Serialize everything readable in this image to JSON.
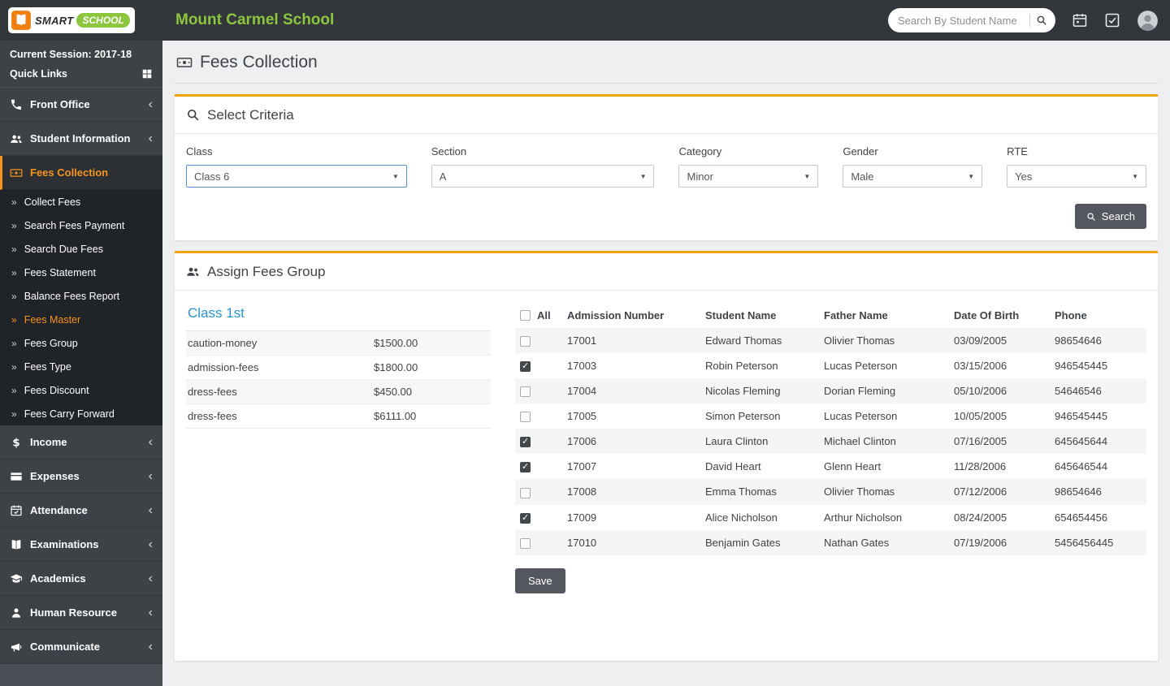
{
  "colors": {
    "accent_orange": "#f0a30a",
    "sidebar_active_orange": "#f7941e",
    "brand_green": "#8cc63e",
    "heading_blue": "#2a93c9",
    "topbar_bg": "#33373c",
    "sidebar_bg": "#3d4247",
    "button_gray": "#54585e"
  },
  "topbar": {
    "brand_part1": "SMART",
    "brand_part2": "SCHOOL",
    "school_name": "Mount Carmel School",
    "search_placeholder": "Search By Student Name"
  },
  "sidebar": {
    "session_label": "Current Session: 2017-18",
    "quick_links_label": "Quick Links",
    "items": [
      {
        "label": "Front Office",
        "icon": "phone-icon"
      },
      {
        "label": "Student Information",
        "icon": "users-icon"
      },
      {
        "label": "Fees Collection",
        "icon": "banknote-icon",
        "active": true
      },
      {
        "label": "Income",
        "icon": "dollar-icon"
      },
      {
        "label": "Expenses",
        "icon": "card-icon"
      },
      {
        "label": "Attendance",
        "icon": "calendar-check-icon"
      },
      {
        "label": "Examinations",
        "icon": "book-icon"
      },
      {
        "label": "Academics",
        "icon": "gradcap-icon"
      },
      {
        "label": "Human Resource",
        "icon": "hr-icon"
      },
      {
        "label": "Communicate",
        "icon": "megaphone-icon"
      }
    ],
    "submenu": [
      {
        "label": "Collect Fees"
      },
      {
        "label": "Search Fees Payment"
      },
      {
        "label": "Search Due Fees"
      },
      {
        "label": "Fees Statement"
      },
      {
        "label": "Balance Fees Report"
      },
      {
        "label": "Fees Master",
        "active": true
      },
      {
        "label": "Fees Group"
      },
      {
        "label": "Fees Type"
      },
      {
        "label": "Fees Discount"
      },
      {
        "label": "Fees Carry Forward"
      }
    ]
  },
  "page": {
    "title": "Fees Collection"
  },
  "criteria": {
    "title": "Select Criteria",
    "fields": [
      {
        "label": "Class",
        "value": "Class 6",
        "focused": true
      },
      {
        "label": "Section",
        "value": "A"
      },
      {
        "label": "Category",
        "value": "Minor"
      },
      {
        "label": "Gender",
        "value": "Male"
      },
      {
        "label": "RTE",
        "value": "Yes"
      }
    ],
    "search_button": "Search"
  },
  "assign": {
    "title": "Assign Fees Group",
    "class_heading": "Class 1st",
    "fees": [
      {
        "name": "caution-money",
        "amount": "$1500.00"
      },
      {
        "name": "admission-fees",
        "amount": "$1800.00"
      },
      {
        "name": "dress-fees",
        "amount": "$450.00"
      },
      {
        "name": "dress-fees",
        "amount": "$6111.00"
      }
    ],
    "table": {
      "headers": [
        "All",
        "Admission Number",
        "Student Name",
        "Father Name",
        "Date Of Birth",
        "Phone"
      ],
      "rows": [
        {
          "checked": false,
          "admission": "17001",
          "student": "Edward Thomas",
          "father": "Olivier Thomas",
          "dob": "03/09/2005",
          "phone": "98654646"
        },
        {
          "checked": true,
          "admission": "17003",
          "student": "Robin Peterson",
          "father": "Lucas Peterson",
          "dob": "03/15/2006",
          "phone": "946545445"
        },
        {
          "checked": false,
          "admission": "17004",
          "student": "Nicolas Fleming",
          "father": "Dorian Fleming",
          "dob": "05/10/2006",
          "phone": "54646546"
        },
        {
          "checked": false,
          "admission": "17005",
          "student": "Simon Peterson",
          "father": "Lucas Peterson",
          "dob": "10/05/2005",
          "phone": "946545445"
        },
        {
          "checked": true,
          "admission": "17006",
          "student": "Laura Clinton",
          "father": "Michael Clinton",
          "dob": "07/16/2005",
          "phone": "645645644"
        },
        {
          "checked": true,
          "admission": "17007",
          "student": "David Heart",
          "father": "Glenn Heart",
          "dob": "11/28/2006",
          "phone": "645646544"
        },
        {
          "checked": false,
          "admission": "17008",
          "student": "Emma Thomas",
          "father": "Olivier Thomas",
          "dob": "07/12/2006",
          "phone": "98654646"
        },
        {
          "checked": true,
          "admission": "17009",
          "student": "Alice Nicholson",
          "father": "Arthur Nicholson",
          "dob": "08/24/2005",
          "phone": "654654456"
        },
        {
          "checked": false,
          "admission": "17010",
          "student": "Benjamin Gates",
          "father": "Nathan Gates",
          "dob": "07/19/2006",
          "phone": "5456456445"
        }
      ]
    },
    "save_button": "Save"
  }
}
